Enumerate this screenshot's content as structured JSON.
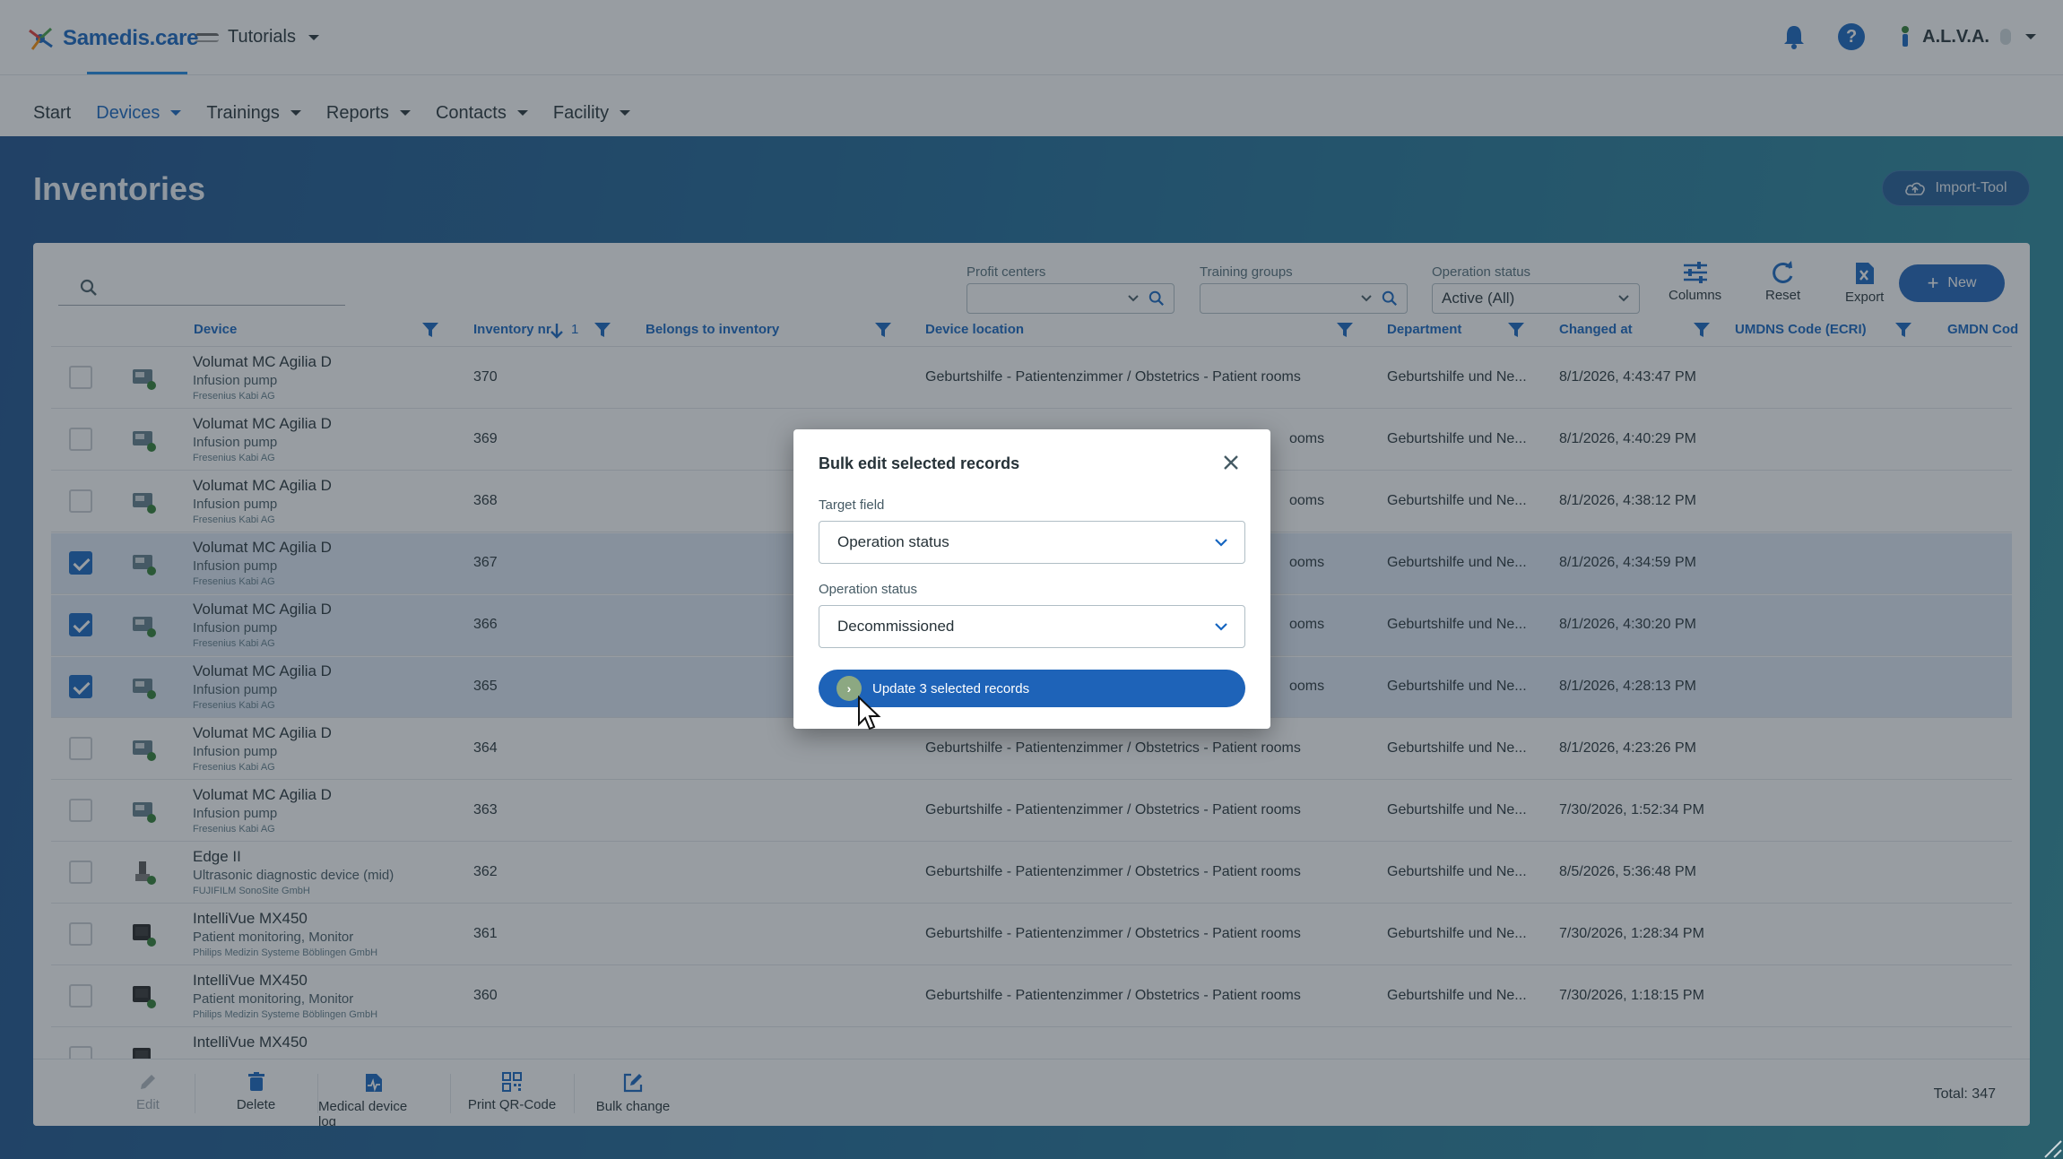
{
  "app": {
    "logo": "Samedis.care",
    "workspace": "Tutorials",
    "user": "A.L.V.A."
  },
  "nav": {
    "items": [
      "Start",
      "Devices",
      "Trainings",
      "Reports",
      "Contacts",
      "Facility"
    ],
    "active": "Devices"
  },
  "page": {
    "title": "Inventories",
    "import_label": "Import-Tool"
  },
  "toolbar": {
    "search_placeholder": "",
    "profit_centers_label": "Profit centers",
    "training_groups_label": "Training groups",
    "operation_status_label": "Operation status",
    "operation_status_value": "Active (All)",
    "columns_label": "Columns",
    "reset_label": "Reset",
    "export_label": "Export",
    "new_label": "New"
  },
  "columns": {
    "device": "Device",
    "inventory_nr": "Inventory nr.",
    "sort_index": "1",
    "belongs_to": "Belongs to inventory",
    "location": "Device location",
    "department": "Department",
    "changed_at": "Changed at",
    "umdns": "UMDNS Code (ECRI)",
    "gmdn": "GMDN Cod"
  },
  "rows": [
    {
      "name": "Volumat MC Agilia D",
      "type": "Infusion pump",
      "maker": "Fresenius Kabi AG",
      "inv": "370",
      "location": "Geburtshilfe - Patientenzimmer / Obstetrics - Patient rooms",
      "dept": "Geburtshilfe und Ne...",
      "changed": "8/1/2026, 4:43:47 PM",
      "checked": false
    },
    {
      "name": "Volumat MC Agilia D",
      "type": "Infusion pump",
      "maker": "Fresenius Kabi AG",
      "inv": "369",
      "location": "ooms",
      "dept": "Geburtshilfe und Ne...",
      "changed": "8/1/2026, 4:40:29 PM",
      "checked": false
    },
    {
      "name": "Volumat MC Agilia D",
      "type": "Infusion pump",
      "maker": "Fresenius Kabi AG",
      "inv": "368",
      "location": "ooms",
      "dept": "Geburtshilfe und Ne...",
      "changed": "8/1/2026, 4:38:12 PM",
      "checked": false
    },
    {
      "name": "Volumat MC Agilia D",
      "type": "Infusion pump",
      "maker": "Fresenius Kabi AG",
      "inv": "367",
      "location": "ooms",
      "dept": "Geburtshilfe und Ne...",
      "changed": "8/1/2026, 4:34:59 PM",
      "checked": true
    },
    {
      "name": "Volumat MC Agilia D",
      "type": "Infusion pump",
      "maker": "Fresenius Kabi AG",
      "inv": "366",
      "location": "ooms",
      "dept": "Geburtshilfe und Ne...",
      "changed": "8/1/2026, 4:30:20 PM",
      "checked": true
    },
    {
      "name": "Volumat MC Agilia D",
      "type": "Infusion pump",
      "maker": "Fresenius Kabi AG",
      "inv": "365",
      "location": "ooms",
      "dept": "Geburtshilfe und Ne...",
      "changed": "8/1/2026, 4:28:13 PM",
      "checked": true
    },
    {
      "name": "Volumat MC Agilia D",
      "type": "Infusion pump",
      "maker": "Fresenius Kabi AG",
      "inv": "364",
      "location": "Geburtshilfe - Patientenzimmer / Obstetrics - Patient rooms",
      "dept": "Geburtshilfe und Ne...",
      "changed": "8/1/2026, 4:23:26 PM",
      "checked": false
    },
    {
      "name": "Volumat MC Agilia D",
      "type": "Infusion pump",
      "maker": "Fresenius Kabi AG",
      "inv": "363",
      "location": "Geburtshilfe - Patientenzimmer / Obstetrics - Patient rooms",
      "dept": "Geburtshilfe und Ne...",
      "changed": "7/30/2026, 1:52:34 PM",
      "checked": false
    },
    {
      "name": "Edge II",
      "type": "Ultrasonic diagnostic device (mid)",
      "maker": "FUJIFILM SonoSite GmbH",
      "inv": "362",
      "location": "Geburtshilfe - Patientenzimmer / Obstetrics - Patient rooms",
      "dept": "Geburtshilfe und Ne...",
      "changed": "8/5/2026, 5:36:48 PM",
      "checked": false
    },
    {
      "name": "IntelliVue MX450",
      "type": "Patient monitoring, Monitor",
      "maker": "Philips Medizin Systeme Böblingen GmbH",
      "inv": "361",
      "location": "Geburtshilfe - Patientenzimmer / Obstetrics - Patient rooms",
      "dept": "Geburtshilfe und Ne...",
      "changed": "7/30/2026, 1:28:34 PM",
      "checked": false
    },
    {
      "name": "IntelliVue MX450",
      "type": "Patient monitoring, Monitor",
      "maker": "Philips Medizin Systeme Böblingen GmbH",
      "inv": "360",
      "location": "Geburtshilfe - Patientenzimmer / Obstetrics - Patient rooms",
      "dept": "Geburtshilfe und Ne...",
      "changed": "7/30/2026, 1:18:15 PM",
      "checked": false
    },
    {
      "name": "IntelliVue MX450",
      "type": "",
      "maker": "",
      "inv": "",
      "location": "",
      "dept": "",
      "changed": "",
      "checked": false
    }
  ],
  "footer": {
    "edit": "Edit",
    "delete": "Delete",
    "log": "Medical device log",
    "qr": "Print QR-Code",
    "bulk": "Bulk change",
    "total": "Total: 347"
  },
  "dialog": {
    "title": "Bulk edit selected records",
    "target_label": "Target field",
    "target_value": "Operation status",
    "status_label": "Operation status",
    "status_value": "Decommissioned",
    "update_label": "Update 3 selected records"
  },
  "colors": {
    "accent": "#1e63b8",
    "link": "#1565c0",
    "selected_row": "#dfe9f6"
  }
}
